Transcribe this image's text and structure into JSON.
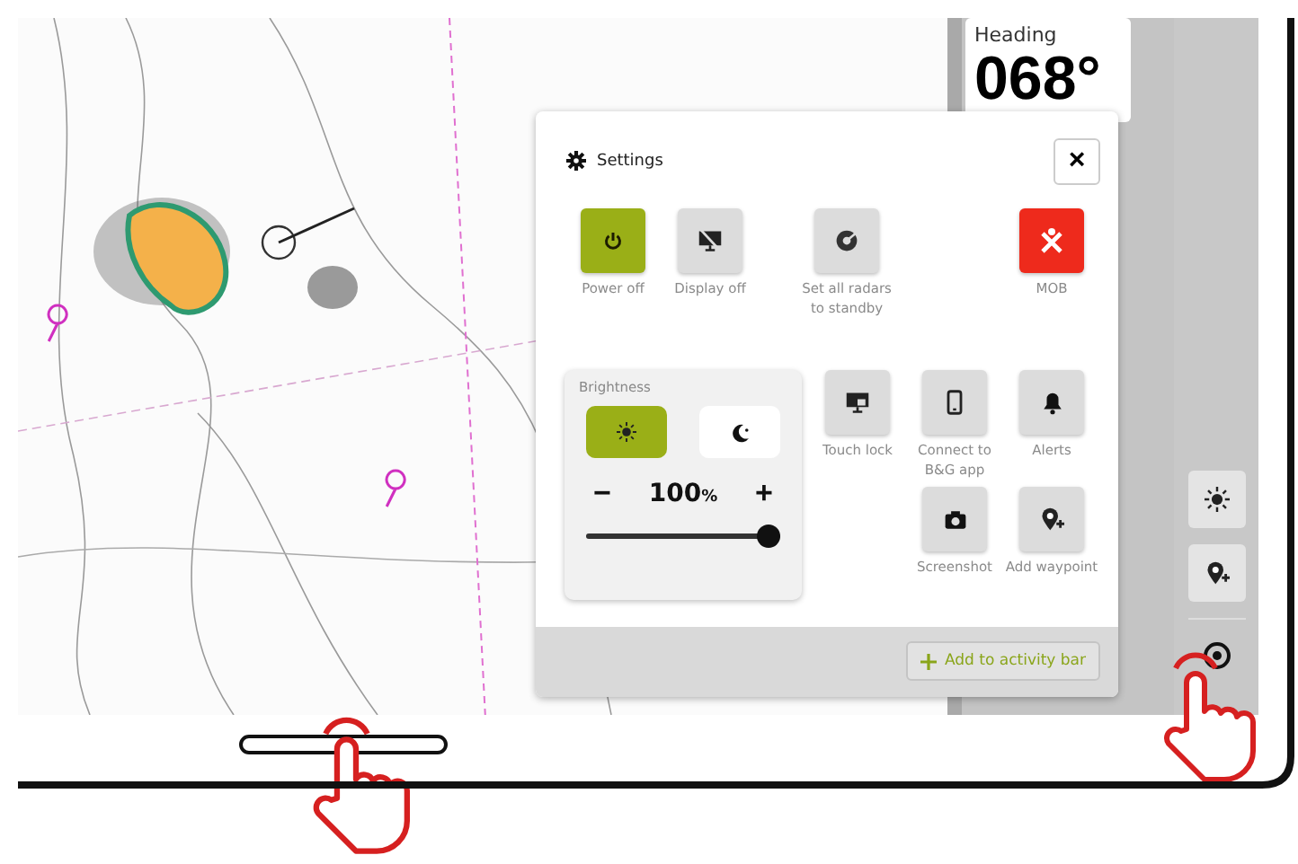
{
  "heading": {
    "label": "Heading",
    "value": "068°"
  },
  "settings": {
    "title": "Settings",
    "close": "×",
    "actions": [
      {
        "label": "Power off",
        "kind": "power"
      },
      {
        "label": "Display off",
        "kind": "display"
      },
      {
        "label": "Set all radars to standby",
        "kind": "radar"
      },
      {
        "label": "MOB",
        "kind": "mob"
      }
    ],
    "brightness": {
      "label": "Brightness",
      "modes": [
        {
          "kind": "day",
          "selected": true
        },
        {
          "kind": "night",
          "selected": false
        }
      ],
      "minus": "−",
      "value": "100",
      "unit": "%",
      "plus": "+",
      "level": 1.0
    },
    "tile_rows": [
      [
        {
          "label": "Touch lock",
          "kind": "lock"
        },
        {
          "label": "Connect to B&G app",
          "kind": "phone"
        },
        {
          "label": "Alerts",
          "kind": "bell"
        }
      ],
      [
        {
          "label": "Screenshot",
          "kind": "camera"
        },
        {
          "label": "Add waypoint",
          "kind": "waypoint"
        }
      ]
    ],
    "add_button": "Add to activity bar"
  },
  "activity_bar": [
    {
      "kind": "brightness"
    },
    {
      "kind": "waypoint"
    },
    {
      "kind": "settings"
    }
  ]
}
